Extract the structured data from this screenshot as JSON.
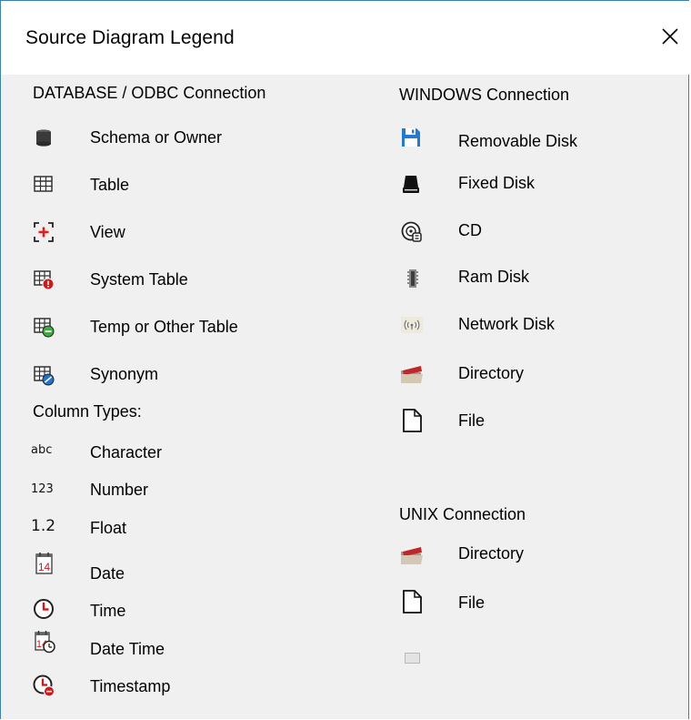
{
  "window": {
    "title": "Source Diagram Legend",
    "close_label": "close"
  },
  "db": {
    "heading": "DATABASE / ODBC  Connection",
    "items": [
      {
        "label": "Schema or Owner",
        "icon": "schema-icon"
      },
      {
        "label": "Table",
        "icon": "table-icon"
      },
      {
        "label": "View",
        "icon": "view-icon"
      },
      {
        "label": "System Table",
        "icon": "system-table-icon"
      },
      {
        "label": "Temp or Other Table",
        "icon": "temp-table-icon"
      },
      {
        "label": "Synonym",
        "icon": "synonym-icon"
      }
    ]
  },
  "columns": {
    "heading": "Column Types:",
    "items": [
      {
        "label": "Character",
        "icon_text": "abc"
      },
      {
        "label": "Number",
        "icon_text": "123"
      },
      {
        "label": "Float",
        "icon_text": "1.2"
      },
      {
        "label": "Date",
        "icon_text": "14"
      },
      {
        "label": "Time",
        "icon": "clock-icon"
      },
      {
        "label": "Date Time",
        "icon_text": "14"
      },
      {
        "label": "Timestamp",
        "icon": "timestamp-icon"
      }
    ]
  },
  "windows": {
    "heading": "WINDOWS Connection",
    "items": [
      {
        "label": "Removable Disk",
        "icon": "floppy-icon"
      },
      {
        "label": "Fixed Disk",
        "icon": "hard-disk-icon"
      },
      {
        "label": "CD",
        "icon": "cd-icon"
      },
      {
        "label": "Ram Disk",
        "icon": "ram-icon"
      },
      {
        "label": "Network Disk",
        "icon": "network-disk-icon"
      },
      {
        "label": "Directory",
        "icon": "folder-icon"
      },
      {
        "label": "File",
        "icon": "file-icon"
      }
    ]
  },
  "unix": {
    "heading": "UNIX Connection",
    "items": [
      {
        "label": "Directory",
        "icon": "folder-icon"
      },
      {
        "label": "File",
        "icon": "file-icon"
      }
    ]
  },
  "colors": {
    "accent_border": "#3c7fb1",
    "folder_red": "#c0272d",
    "blue": "#1e73d2"
  }
}
